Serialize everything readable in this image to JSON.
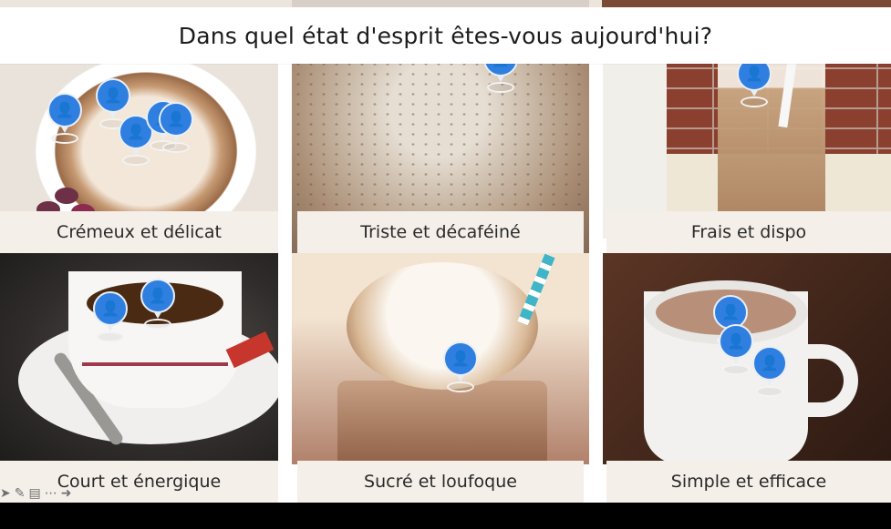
{
  "question": "Dans quel état d'esprit êtes-vous aujourd'hui?",
  "cards": [
    {
      "label": "Crémeux et délicat",
      "votes": 5
    },
    {
      "label": "Triste et décaféiné",
      "votes": 1
    },
    {
      "label": "Frais et dispo",
      "votes": 1
    },
    {
      "label": "Court et énergique",
      "votes": 2
    },
    {
      "label": "Sucré et loufoque",
      "votes": 1
    },
    {
      "label": "Simple et efficace",
      "votes": 3
    }
  ],
  "pin_icon": "person-icon",
  "pin_color": "#2f7fe0",
  "toolbar_icons": [
    "arrow-icon",
    "pencil-icon",
    "comment-icon",
    "more-icon",
    "arrow-right-icon"
  ]
}
